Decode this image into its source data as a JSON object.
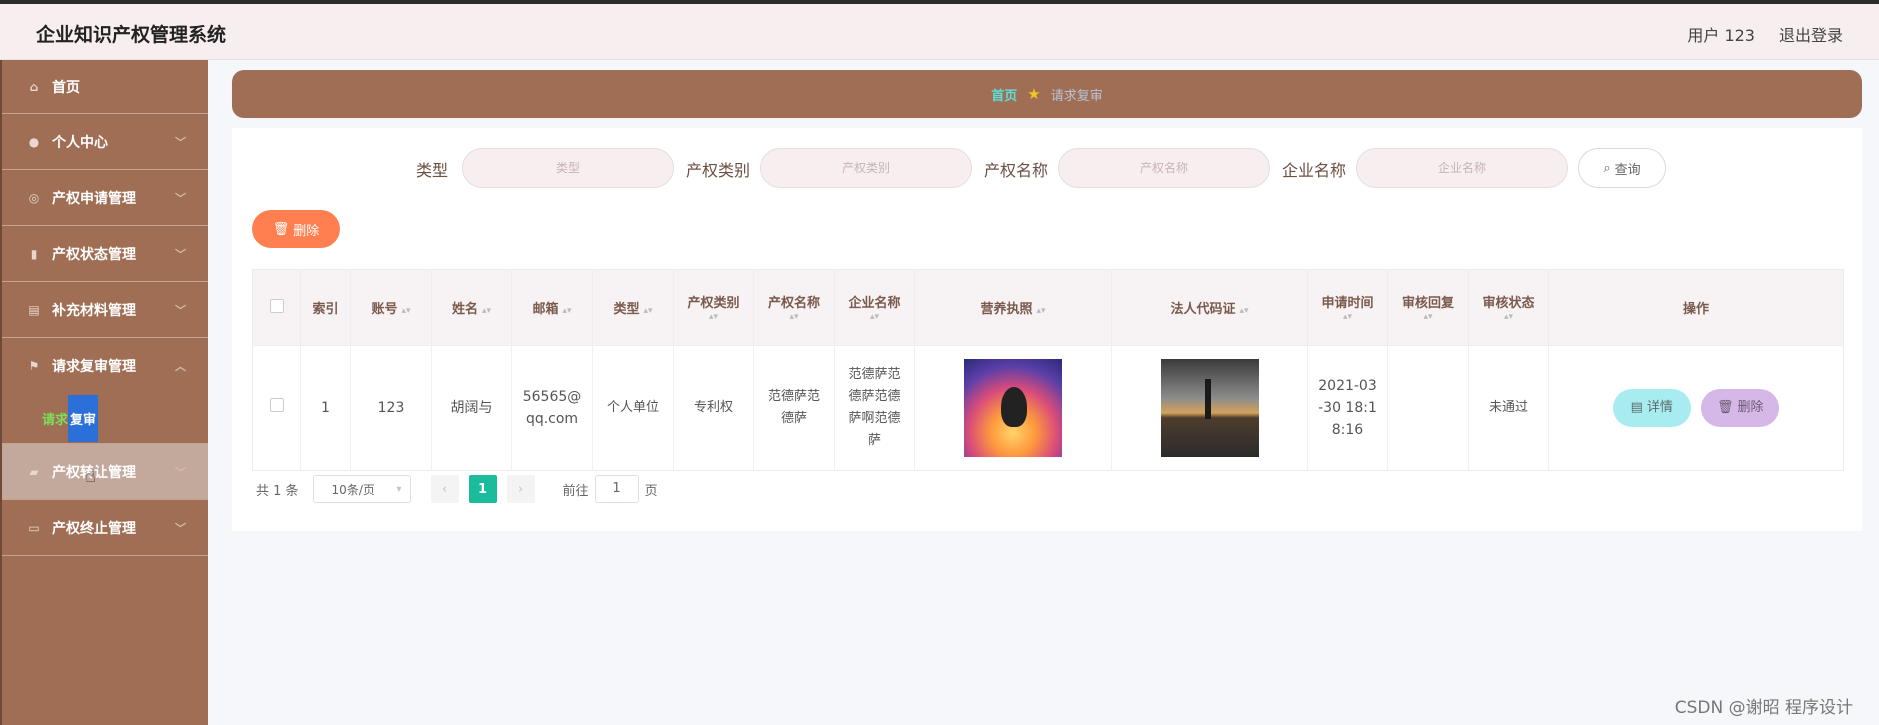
{
  "header": {
    "title": "企业知识产权管理系统",
    "user": "用户 123",
    "logout": "退出登录"
  },
  "sidebar": {
    "items": [
      {
        "label": "首页",
        "icon": "home-icon"
      },
      {
        "label": "个人中心",
        "icon": "user-icon"
      },
      {
        "label": "产权申请管理",
        "icon": "globe-icon"
      },
      {
        "label": "产权状态管理",
        "icon": "chart-icon"
      },
      {
        "label": "补充材料管理",
        "icon": "document-icon"
      },
      {
        "label": "请求复审管理",
        "icon": "flag-icon"
      },
      {
        "label": "产权转让管理",
        "icon": "thumb-icon"
      },
      {
        "label": "产权终止管理",
        "icon": "chat-icon"
      }
    ],
    "submenu": {
      "part_a": "请求",
      "part_b": "复审"
    },
    "hover_label_visible": "产权转让管理"
  },
  "breadcrumb": {
    "home": "首页",
    "current": "请求复审"
  },
  "search": {
    "fields": [
      {
        "label": "类型",
        "placeholder": "类型"
      },
      {
        "label": "产权类别",
        "placeholder": "产权类别"
      },
      {
        "label": "产权名称",
        "placeholder": "产权名称"
      },
      {
        "label": "企业名称",
        "placeholder": "企业名称"
      }
    ],
    "button": "查询"
  },
  "toolbar": {
    "delete": "删除"
  },
  "table": {
    "headers": [
      "索引",
      "账号",
      "姓名",
      "邮箱",
      "类型",
      "产权类别",
      "产权名称",
      "企业名称",
      "营养执照",
      "法人代码证",
      "申请时间",
      "审核回复",
      "审核状态",
      "操作"
    ],
    "rows": [
      {
        "index": "1",
        "account": "123",
        "name": "胡阔与",
        "email": "56565@qq.com",
        "type": "个人单位",
        "category": "专利权",
        "ip_name": "范德萨范德萨",
        "company": "范德萨范德萨范德萨啊范德萨",
        "license_img": "sunset-dolphin-image",
        "legal_img": "lake-tree-image",
        "apply_time": "2021-03-30 18:18:16",
        "review_reply": "",
        "review_status": "未通过",
        "op_detail": "详情",
        "op_delete": "删除"
      }
    ]
  },
  "pagination": {
    "total": "共 1 条",
    "page_size": "10条/页",
    "current": "1",
    "goto_prefix": "前往",
    "goto_value": "1",
    "goto_suffix": "页"
  },
  "watermark": "CSDN @谢昭 程序设计",
  "colors": {
    "sidebar": "#a06e54",
    "accent_green": "#1abc9c",
    "delete_orange": "#ff7f50"
  }
}
